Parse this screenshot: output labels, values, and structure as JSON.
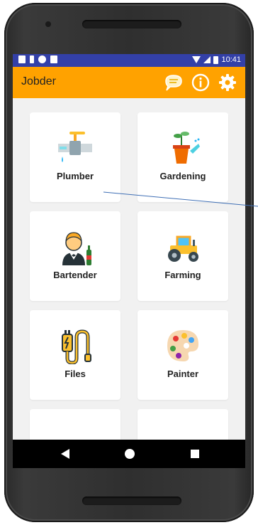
{
  "status_bar": {
    "time": "10:41"
  },
  "app_bar": {
    "title": "Jobder"
  },
  "categories": [
    {
      "label": "Plumber"
    },
    {
      "label": "Gardening"
    },
    {
      "label": "Bartender"
    },
    {
      "label": "Farming"
    },
    {
      "label": "Files"
    },
    {
      "label": "Painter"
    }
  ],
  "colors": {
    "status_bar": "#3340a8",
    "app_bar": "#ffa200",
    "background": "#f1f1f1",
    "navbar": "#000000"
  },
  "icons": {
    "chat": "chat-bubble-icon",
    "info": "info-icon",
    "settings": "gear-icon"
  }
}
